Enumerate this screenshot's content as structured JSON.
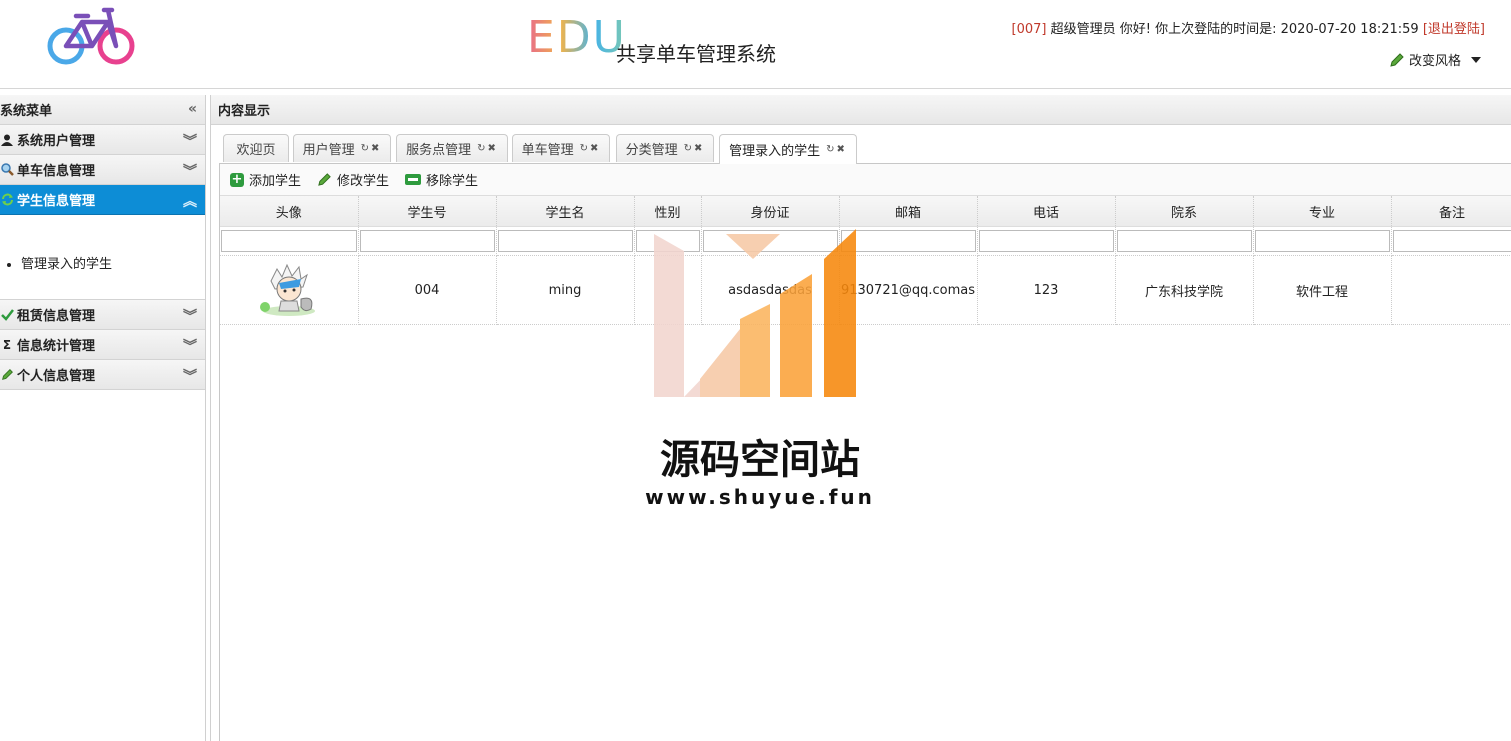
{
  "header": {
    "title_edu": "EDU",
    "title_system": "共享单车管理系统",
    "user_id": "[007]",
    "greeting": "超级管理员 你好! 你上次登陆的时间是: 2020-07-20 18:21:59",
    "logout": "[退出登陆]",
    "change_style": "改变风格"
  },
  "sidebar": {
    "title": "系统菜单",
    "panels": [
      {
        "label": "系统用户管理",
        "icon": "user-icon"
      },
      {
        "label": "单车信息管理",
        "icon": "search-icon"
      },
      {
        "label": "学生信息管理",
        "icon": "refresh-icon",
        "active": true,
        "items": [
          "管理录入的学生"
        ]
      },
      {
        "label": "租赁信息管理",
        "icon": "check-icon"
      },
      {
        "label": "信息统计管理",
        "icon": "sigma-icon"
      },
      {
        "label": "个人信息管理",
        "icon": "pencil-icon"
      }
    ]
  },
  "content": {
    "title": "内容显示",
    "tabs": [
      {
        "label": "欢迎页"
      },
      {
        "label": "用户管理"
      },
      {
        "label": "服务点管理"
      },
      {
        "label": "单车管理"
      },
      {
        "label": "分类管理"
      },
      {
        "label": "管理录入的学生",
        "selected": true
      }
    ],
    "toolbar": {
      "add": "添加学生",
      "edit": "修改学生",
      "remove": "移除学生"
    },
    "table": {
      "columns": [
        "头像",
        "学生号",
        "学生名",
        "性别",
        "身份证",
        "邮箱",
        "电话",
        "院系",
        "专业",
        "备注"
      ],
      "rows": [
        {
          "student_no": "004",
          "name": "ming",
          "gender": "",
          "id_card": "asdasdasdas",
          "email": "9130721@qq.comas",
          "phone": "123",
          "department": "广东科技学院",
          "major": "软件工程",
          "remark": ""
        }
      ]
    }
  },
  "watermark": {
    "name": "源码空间站",
    "url": "www.shuyue.fun"
  },
  "colors": {
    "accent": "#0d8dd6",
    "red": "#c0392b",
    "green": "#2e9b3e",
    "orange": "#f39a1e"
  }
}
